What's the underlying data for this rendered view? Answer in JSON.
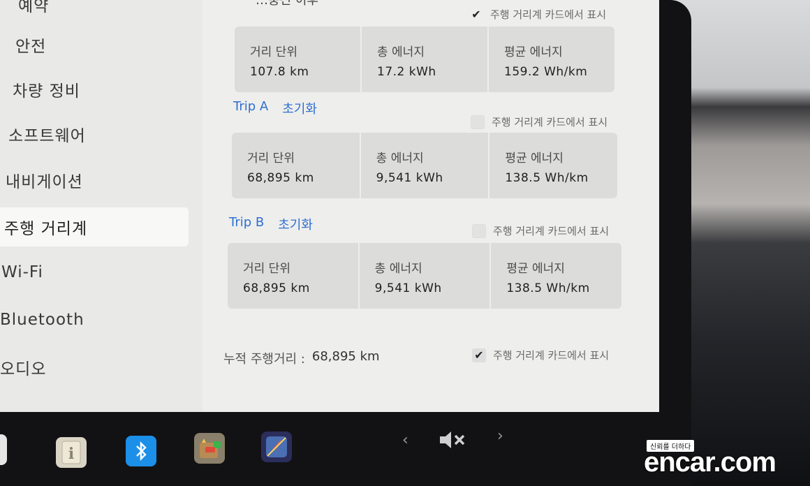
{
  "sidebar": {
    "items": [
      {
        "label": "예약"
      },
      {
        "label": "안전"
      },
      {
        "label": "차량 정비"
      },
      {
        "label": "소프트웨어"
      },
      {
        "label": "내비게이션"
      },
      {
        "label": "주행 거리계"
      },
      {
        "label": "Wi-Fi"
      },
      {
        "label": "Bluetooth"
      },
      {
        "label": "오디오"
      }
    ],
    "active": "주행 거리계"
  },
  "top_section": {
    "title": "…충전 이후",
    "show_on_card": {
      "label": "주행 거리계 카드에서 표시",
      "checked": true
    },
    "stats": [
      {
        "label": "거리 단위",
        "value": "107.8 km"
      },
      {
        "label": "총 에너지",
        "value": "17.2 kWh"
      },
      {
        "label": "평균 에너지",
        "value": "159.2 Wh/km"
      }
    ]
  },
  "trip_a": {
    "title": "Trip A",
    "reset_label": "초기화",
    "show_on_card": {
      "label": "주행 거리계 카드에서 표시",
      "checked": false
    },
    "stats": [
      {
        "label": "거리 단위",
        "value": "68,895 km"
      },
      {
        "label": "총 에너지",
        "value": "9,541 kWh"
      },
      {
        "label": "평균 에너지",
        "value": "138.5 Wh/km"
      }
    ]
  },
  "trip_b": {
    "title": "Trip B",
    "reset_label": "초기화",
    "show_on_card": {
      "label": "주행 거리계 카드에서 표시",
      "checked": false
    },
    "stats": [
      {
        "label": "거리 단위",
        "value": "68,895 km"
      },
      {
        "label": "총 에너지",
        "value": "9,541 kWh"
      },
      {
        "label": "평균 에너지",
        "value": "138.5 Wh/km"
      }
    ]
  },
  "odometer": {
    "label": "누적 주행거리 :",
    "value": "68,895 km",
    "show_on_card": {
      "label": "주행 거리계 카드에서 표시",
      "checked": true
    }
  },
  "dock": {
    "icons": [
      "info-icon",
      "bluetooth-icon",
      "toybox-icon",
      "navigation-icon"
    ],
    "prev": "‹",
    "next": "›",
    "mute_icon": "🔇︎"
  },
  "watermark": {
    "tag": "신뢰를 더하다",
    "text": "encar.com"
  },
  "colors": {
    "accent": "#2f6fd1",
    "screen_bg": "#eeeeec",
    "card_bg": "#dcdcda"
  }
}
